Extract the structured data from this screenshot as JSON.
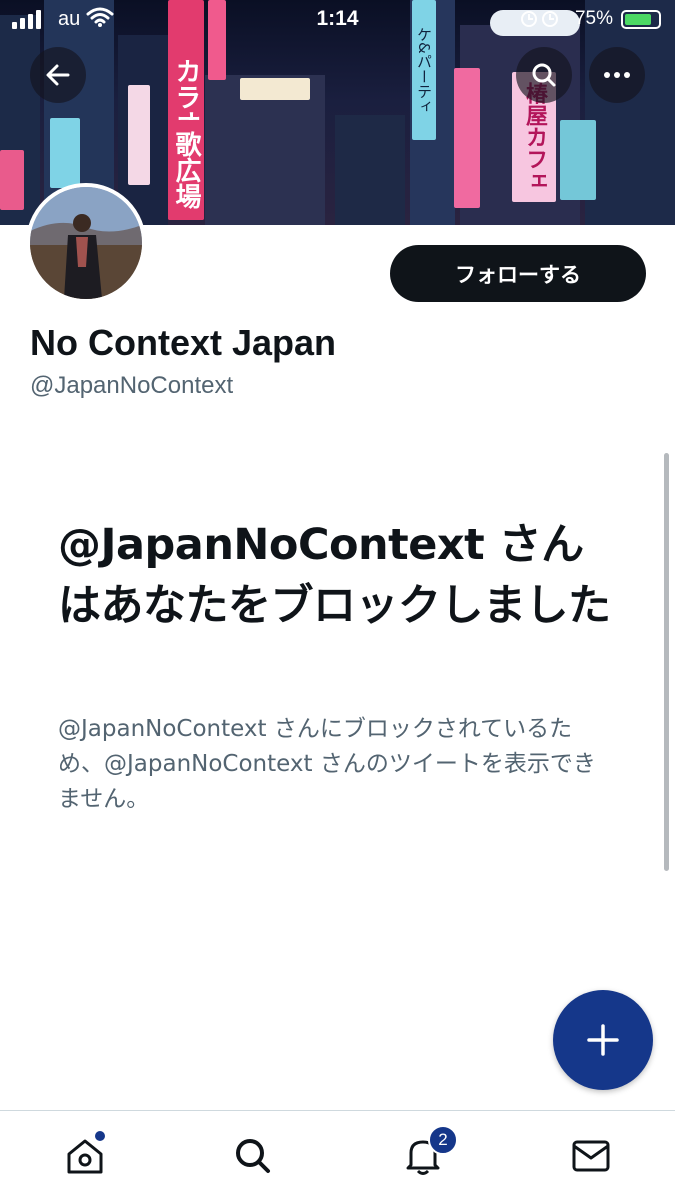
{
  "status_bar": {
    "carrier": "au",
    "time": "1:14",
    "battery_percent": "75%"
  },
  "profile": {
    "display_name": "No Context Japan",
    "handle": "@JapanNoContext",
    "follow_label": "フォローする"
  },
  "banner_signs": {
    "karaoke": "カラオケ",
    "kakyo": "歌広場",
    "cafe": "椿屋カフェ",
    "party": "ケ&パーティ"
  },
  "blocked": {
    "title": "@JapanNoContext さんはあなたをブロックしました",
    "description": "@JapanNoContext さんにブロックされているため、@JapanNoContext さんのツイートを表示できません。"
  },
  "tabbar": {
    "notifications_badge": "2"
  },
  "icons": {
    "back": "arrow-left-icon",
    "search": "search-icon",
    "more": "more-horizontal-icon",
    "compose": "plus-icon",
    "home": "home-icon",
    "explore": "search-icon",
    "notifications": "bell-icon",
    "messages": "envelope-icon"
  },
  "colors": {
    "accent": "#15378a",
    "follow_button": "#0f1419",
    "secondary_text": "#536471"
  }
}
